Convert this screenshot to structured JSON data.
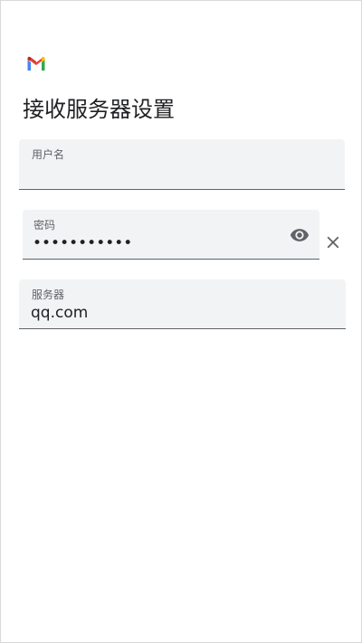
{
  "app": {
    "logo_icon": "gmail-logo-icon",
    "colors": {
      "gmail_blue": "#4285F4",
      "gmail_red": "#EA4335",
      "gmail_yellow": "#FBBC04",
      "gmail_green": "#34A853"
    }
  },
  "page": {
    "title": "接收服务器设置"
  },
  "form": {
    "username": {
      "label": "用户名",
      "value": ""
    },
    "password": {
      "label": "密码",
      "value": "•••••••••••",
      "toggle_icon": "eye-icon",
      "clear_icon": "close-icon"
    },
    "server": {
      "label": "服务器",
      "value": "qq.com"
    }
  }
}
